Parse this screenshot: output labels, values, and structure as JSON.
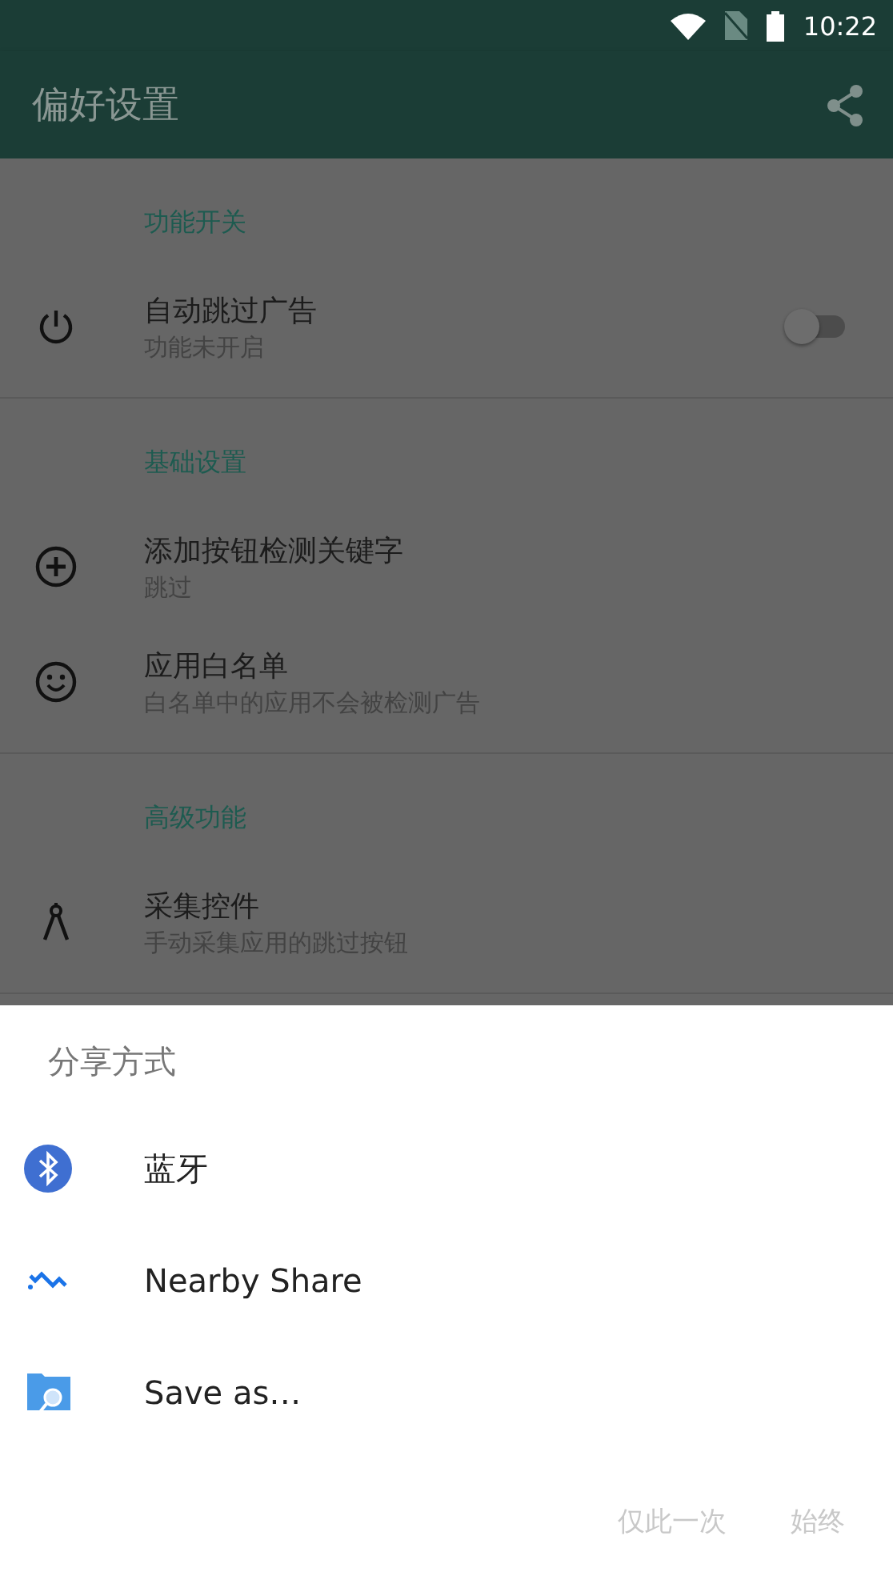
{
  "status_bar": {
    "time": "10:22"
  },
  "app_bar": {
    "title": "偏好设置"
  },
  "sections": [
    {
      "title": "功能开关",
      "items": [
        {
          "title": "自动跳过广告",
          "subtitle": "功能未开启",
          "kind": "switch",
          "on": false
        }
      ]
    },
    {
      "title": "基础设置",
      "items": [
        {
          "title": "添加按钮检测关键字",
          "subtitle": "跳过",
          "kind": "plain"
        },
        {
          "title": "应用白名单",
          "subtitle": "白名单中的应用不会被检测广告",
          "kind": "plain"
        }
      ]
    },
    {
      "title": "高级功能",
      "items": [
        {
          "title": "采集控件",
          "subtitle": "手动采集应用的跳过按钮",
          "kind": "plain"
        }
      ]
    }
  ],
  "share_sheet": {
    "title": "分享方式",
    "targets": [
      {
        "label": "蓝牙"
      },
      {
        "label": "Nearby Share"
      },
      {
        "label": "Save as…"
      }
    ],
    "buttons": [
      {
        "label": "仅此一次",
        "disabled": true
      },
      {
        "label": "始终",
        "disabled": true
      }
    ]
  }
}
